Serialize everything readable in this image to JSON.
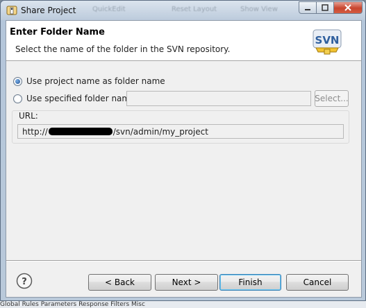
{
  "window": {
    "title": "Share Project",
    "background_toolbar": [
      "QuickEdit",
      "Reset Layout",
      "Show View"
    ]
  },
  "banner": {
    "title": "Enter Folder Name",
    "description": "Select the name of the folder in the SVN repository.",
    "logo_text": "SVN"
  },
  "options": {
    "use_project_name": {
      "label": "Use project name as folder name",
      "selected": true
    },
    "use_specified": {
      "label": "Use specified folder name:",
      "selected": false
    },
    "folder_input": {
      "value": "",
      "placeholder": ""
    },
    "select_button": "Select..."
  },
  "url": {
    "label": "URL:",
    "prefix": "http://",
    "suffix": "/svn/admin/my_project"
  },
  "buttons": {
    "back": "< Back",
    "next": "Next >",
    "finish": "Finish",
    "cancel": "Cancel"
  },
  "background_tabs": "Global Rules   Parameters   Response Filters   Misc"
}
